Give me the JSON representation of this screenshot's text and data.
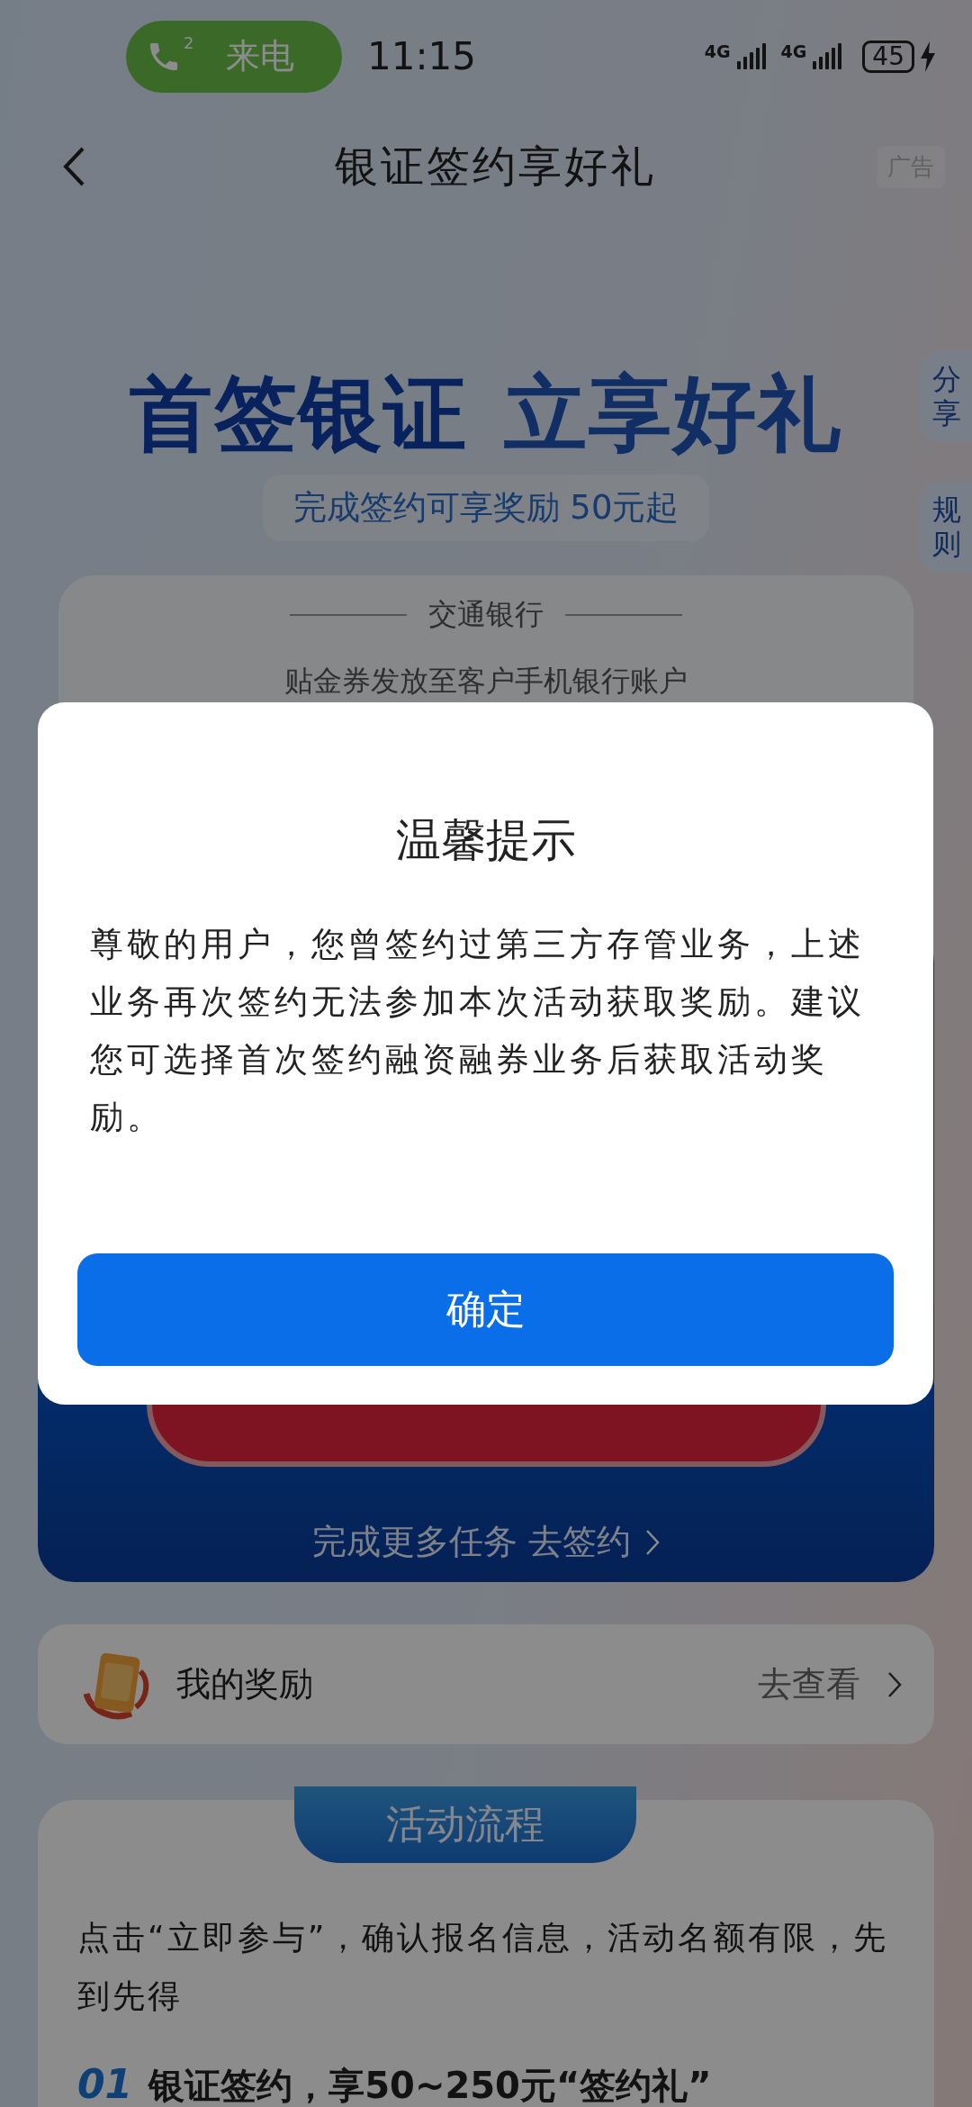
{
  "status_bar": {
    "call_pill": {
      "count": "2",
      "label": "来电"
    },
    "time": "11:15",
    "networks": [
      "4G",
      "4G"
    ],
    "battery": "45"
  },
  "nav": {
    "title": "银证签约享好礼",
    "ad_label": "广告"
  },
  "side_tabs": [
    "分享",
    "规则"
  ],
  "banner": {
    "headline_1": "首签银证",
    "headline_2": "立享好礼",
    "subtitle": "完成签约可享奖励 50元起"
  },
  "bank_card": {
    "bank": "交通银行",
    "note": "贴金券发放至客户手机银行账户"
  },
  "task_card": {
    "link": "完成更多任务 去签约"
  },
  "rewards": {
    "label": "我的奖励",
    "action": "去查看"
  },
  "process": {
    "title": "活动流程",
    "intro": "点击“立即参与”，确认报名信息，活动名额有限，先到先得",
    "step": {
      "number": "01",
      "text": "银证签约，享50~250元“签约礼”"
    }
  },
  "dialog": {
    "title": "温馨提示",
    "message": "尊敬的用户，您曾签约过第三方存管业务，上述业务再次签约无法参加本次活动获取奖励。建议您可选择首次签约融资融券业务后获取活动奖励。",
    "button": "确定"
  }
}
